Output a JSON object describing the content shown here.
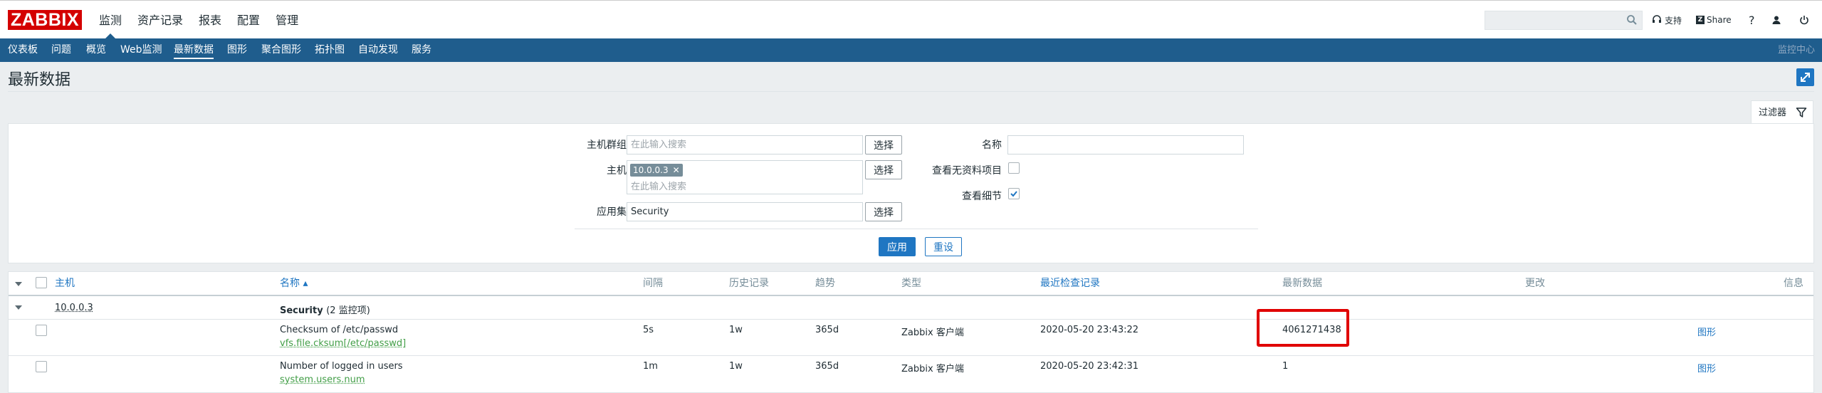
{
  "header": {
    "logo": "ZABBIX",
    "main_menu": [
      "监测",
      "资产记录",
      "报表",
      "配置",
      "管理"
    ],
    "search_placeholder": "",
    "support": "支持",
    "share": "Share",
    "help": "?"
  },
  "subnav": {
    "items": [
      "仪表板",
      "问题",
      "概览",
      "Web监测",
      "最新数据",
      "图形",
      "聚合图形",
      "拓扑图",
      "自动发现",
      "服务"
    ],
    "selected": "最新数据",
    "right_label": "监控中心"
  },
  "page": {
    "title": "最新数据"
  },
  "filter": {
    "tab_label": "过滤器",
    "host_group_label": "主机群组",
    "host_group_placeholder": "在此输入搜索",
    "host_label": "主机",
    "host_tag": "10.0.0.3",
    "host_placeholder": "在此输入搜索",
    "app_label": "应用集",
    "app_value": "Security",
    "select_btn": "选择",
    "name_label": "名称",
    "name_value": "",
    "show_no_data_label": "查看无资料项目",
    "show_details_label": "查看细节",
    "show_no_data": false,
    "show_details": true,
    "apply_btn": "应用",
    "reset_btn": "重设"
  },
  "table": {
    "headers": {
      "host": "主机",
      "name": "名称 ▴",
      "interval": "间隔",
      "history": "历史记录",
      "trends": "趋势",
      "type": "类型",
      "last_check": "最近检查记录",
      "last_value": "最新数据",
      "change": "更改",
      "info": "信息"
    },
    "group": {
      "host": "10.0.0.3",
      "app": "Security",
      "app_count": "(2 监控项)"
    },
    "rows": [
      {
        "name": "Checksum of /etc/passwd",
        "key": "vfs.file.cksum[/etc/passwd]",
        "interval": "5s",
        "history": "1w",
        "trends": "365d",
        "type": "Zabbix 客户端",
        "last_check": "2020-05-20 23:43:22",
        "last_value": "4061271438",
        "change": "",
        "graph": "图形"
      },
      {
        "name": "Number of logged in users",
        "key": "system.users.num",
        "interval": "1m",
        "history": "1w",
        "trends": "365d",
        "type": "Zabbix 客户端",
        "last_check": "2020-05-20 23:42:31",
        "last_value": "1",
        "change": "",
        "graph": "图形"
      }
    ]
  },
  "colors": {
    "brand": "#d40000",
    "nav": "#1f5d8d",
    "link": "#1f76c2",
    "key_green": "#429e47",
    "highlight": "#e00000"
  }
}
